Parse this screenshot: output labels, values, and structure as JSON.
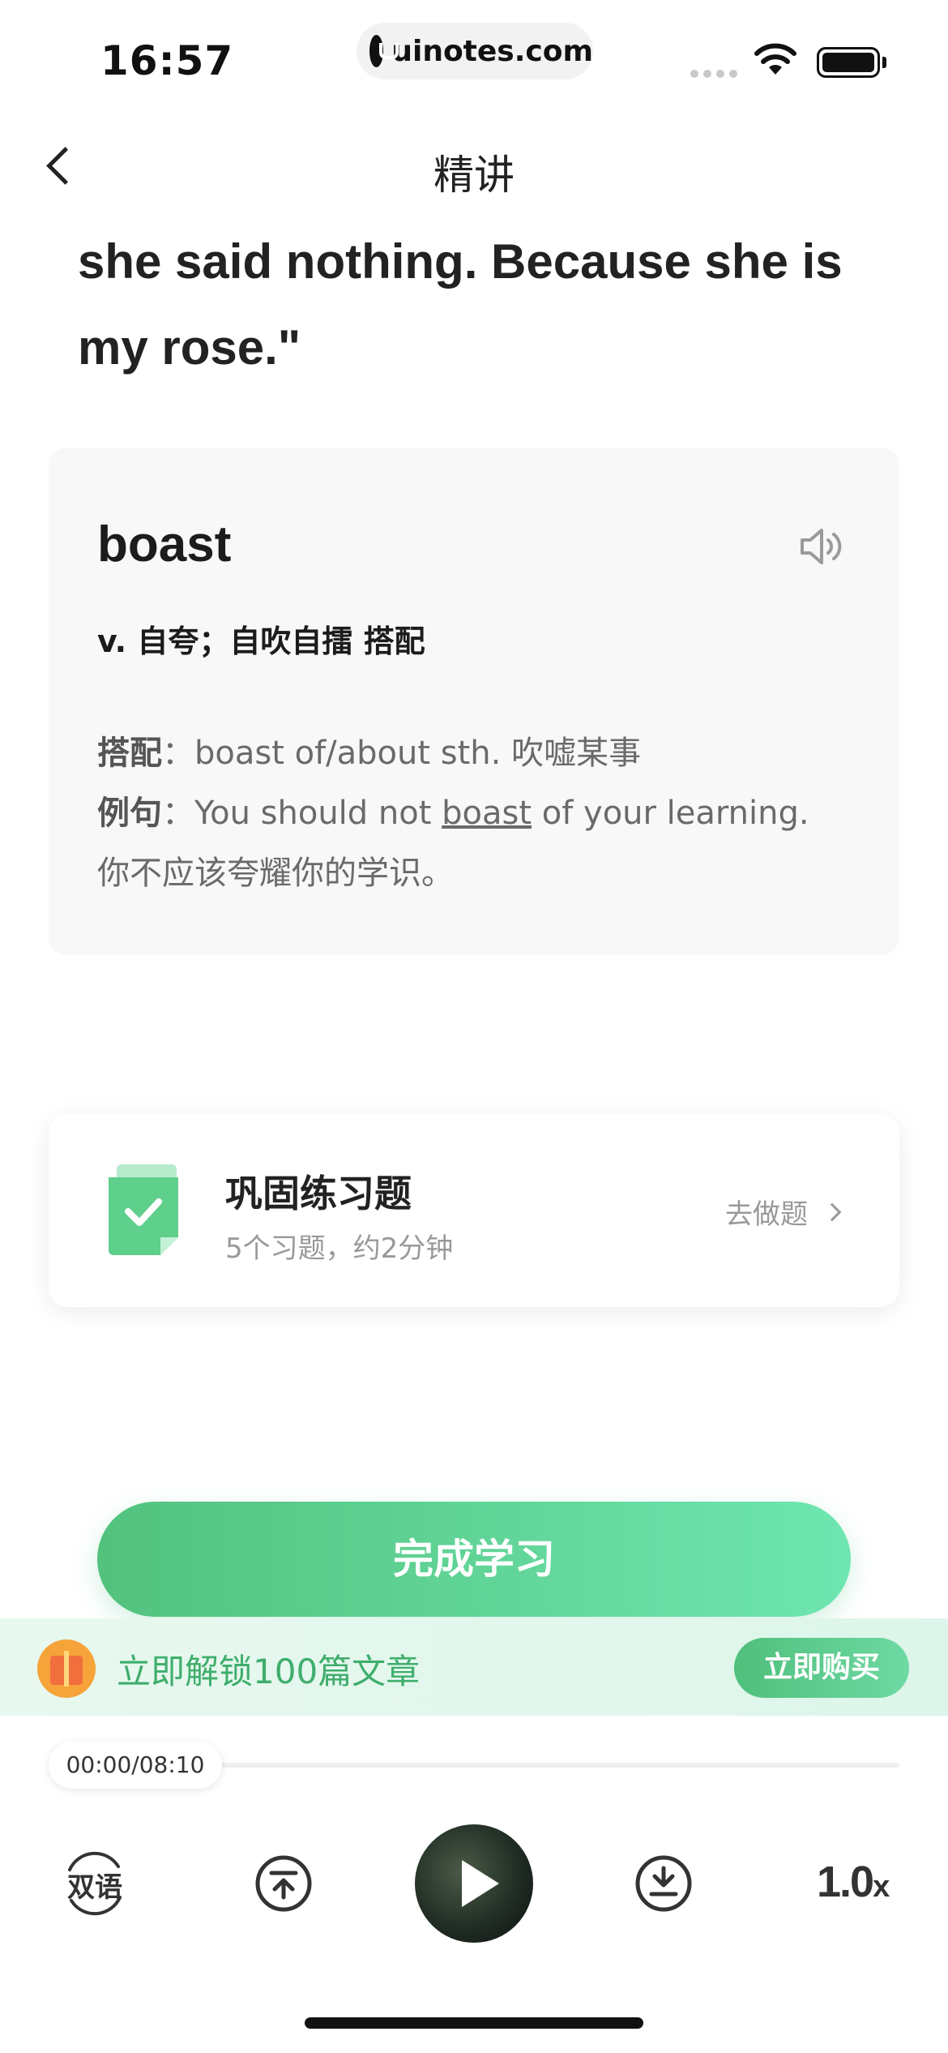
{
  "status_bar": {
    "time": "16:57",
    "url": "uinotes.com"
  },
  "nav": {
    "title": "精讲"
  },
  "article": {
    "lines": [
      "she said nothing. Because she is",
      "my rose.\""
    ]
  },
  "word_card": {
    "word": "boast",
    "pos_meaning": "v. 自夸；自吹自擂 搭配",
    "collocation_label": "搭配",
    "collocation_text": "boast of/about sth. 吹嘘某事",
    "example_label": "例句",
    "example_before": "You should not ",
    "example_word": "boast",
    "example_after": " of your learning.",
    "example_translation": "你不应该夸耀你的学识。",
    "separator": "："
  },
  "practice": {
    "title": "巩固练习题",
    "subtitle": "5个习题，约2分钟",
    "action": "去做题"
  },
  "finish_button": "完成学习",
  "promo": {
    "text": "立即解锁100篇文章",
    "buy_label": "立即购买"
  },
  "player": {
    "time_display": "00:00/08:10",
    "progress": 0,
    "bilingual_label": "双语",
    "speed_value": "1.0",
    "speed_unit": "x"
  },
  "colors": {
    "accent_green": "#52c27d",
    "promo_text": "#3fae6c"
  }
}
